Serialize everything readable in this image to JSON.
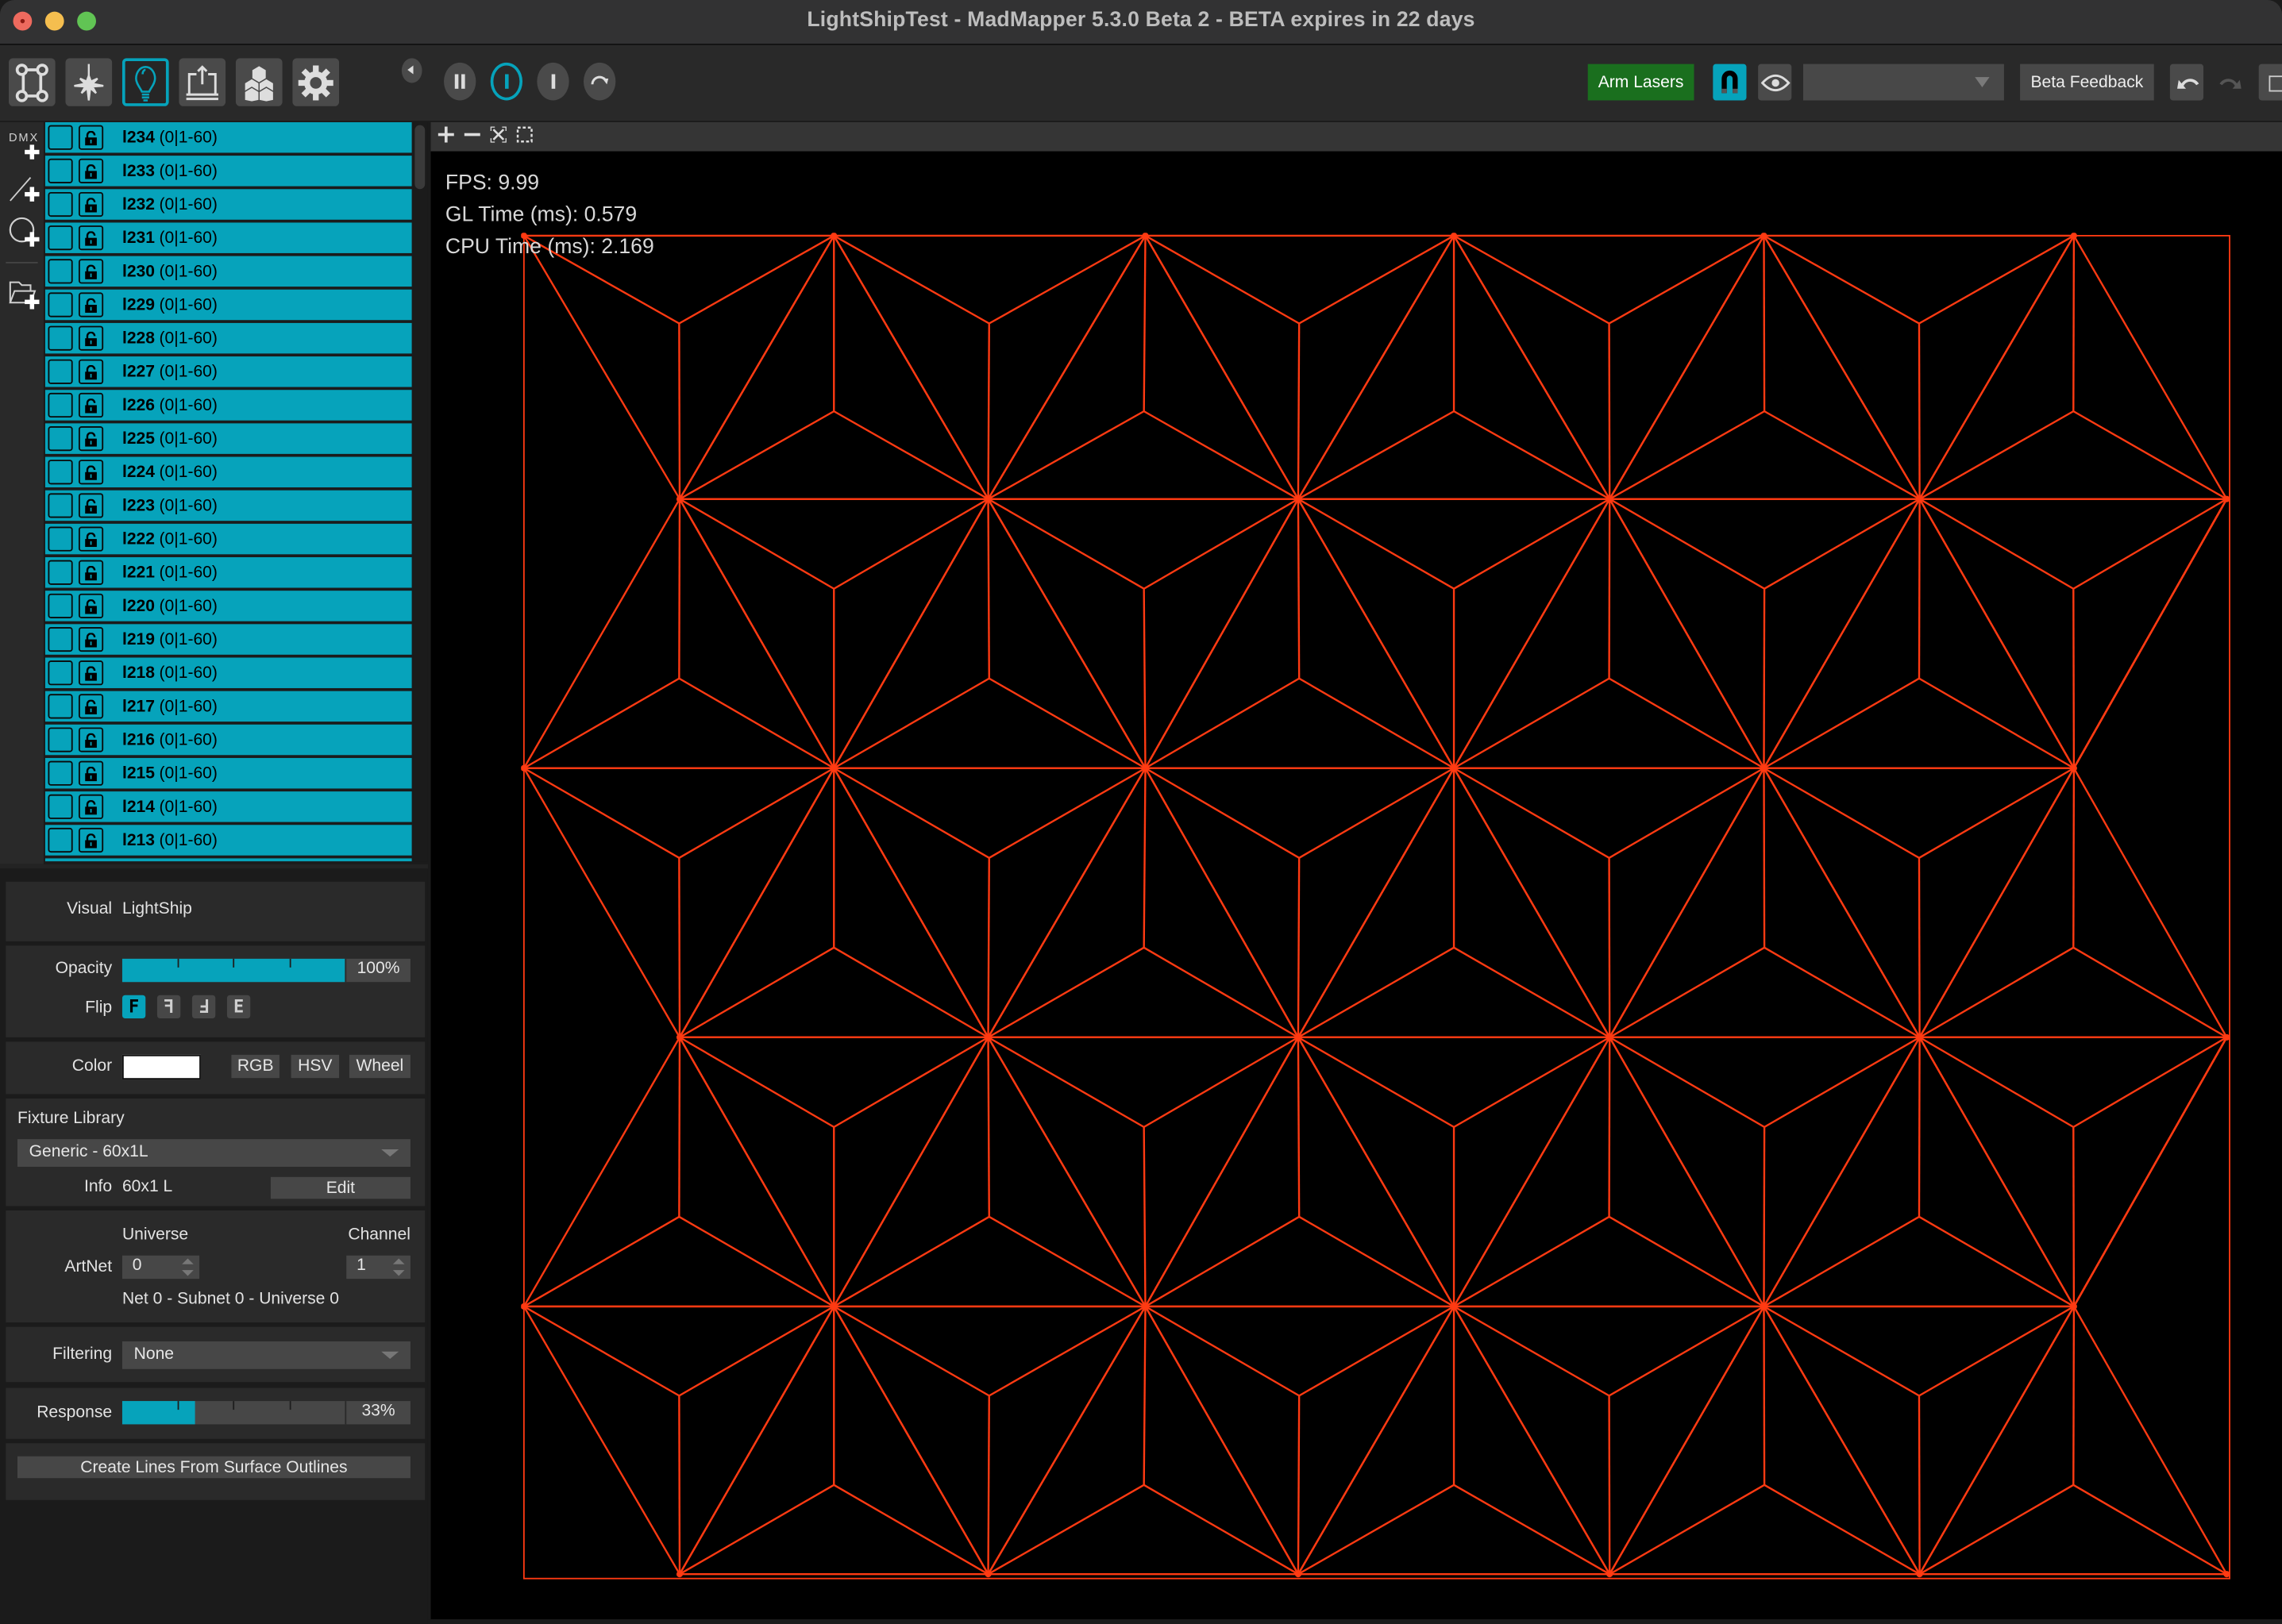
{
  "window": {
    "title": "LightShipTest - MadMapper 5.3.0 Beta 2 - BETA expires in 22 days"
  },
  "toolbar": {
    "mode_buttons": [
      {
        "name": "surfaces-mode",
        "icon": "quad-surface-icon",
        "active": false
      },
      {
        "name": "lasers-mode",
        "icon": "laser-burst-icon",
        "active": false
      },
      {
        "name": "fixtures-mode",
        "icon": "light-bulb-icon",
        "active": true
      },
      {
        "name": "output-mode",
        "icon": "output-export-icon",
        "active": false
      },
      {
        "name": "3d-objects-mode",
        "icon": "cubes-icon",
        "active": false
      },
      {
        "name": "preferences-mode",
        "icon": "gear-icon",
        "active": false
      }
    ],
    "transport": [
      {
        "name": "pause",
        "icon": "pause-icon",
        "active": false
      },
      {
        "name": "play",
        "icon": "play-bar-icon",
        "active": true
      },
      {
        "name": "step",
        "icon": "step-bar-icon",
        "active": false
      },
      {
        "name": "loop",
        "icon": "loop-arrow-icon",
        "active": false
      }
    ],
    "arm_lasers_label": "Arm Lasers",
    "output_select_value": "",
    "beta_feedback_label": "Beta Feedback",
    "accent_color": "#06a3bb",
    "arm_lasers_color": "#1a6f1e"
  },
  "left_strip": {
    "dmx_label": "DMX",
    "icons": [
      "dmx-add-icon",
      "line-add-icon",
      "circle-add-icon",
      "folder-add-icon"
    ]
  },
  "fixture_list": {
    "rows": [
      {
        "name": "l234",
        "range": "(0|1-60)"
      },
      {
        "name": "l233",
        "range": "(0|1-60)"
      },
      {
        "name": "l232",
        "range": "(0|1-60)"
      },
      {
        "name": "l231",
        "range": "(0|1-60)"
      },
      {
        "name": "l230",
        "range": "(0|1-60)"
      },
      {
        "name": "l229",
        "range": "(0|1-60)"
      },
      {
        "name": "l228",
        "range": "(0|1-60)"
      },
      {
        "name": "l227",
        "range": "(0|1-60)"
      },
      {
        "name": "l226",
        "range": "(0|1-60)"
      },
      {
        "name": "l225",
        "range": "(0|1-60)"
      },
      {
        "name": "l224",
        "range": "(0|1-60)"
      },
      {
        "name": "l223",
        "range": "(0|1-60)"
      },
      {
        "name": "l222",
        "range": "(0|1-60)"
      },
      {
        "name": "l221",
        "range": "(0|1-60)"
      },
      {
        "name": "l220",
        "range": "(0|1-60)"
      },
      {
        "name": "l219",
        "range": "(0|1-60)"
      },
      {
        "name": "l218",
        "range": "(0|1-60)"
      },
      {
        "name": "l217",
        "range": "(0|1-60)"
      },
      {
        "name": "l216",
        "range": "(0|1-60)"
      },
      {
        "name": "l215",
        "range": "(0|1-60)"
      },
      {
        "name": "l214",
        "range": "(0|1-60)"
      },
      {
        "name": "l213",
        "range": "(0|1-60)"
      },
      {
        "name": "",
        "range": ""
      }
    ],
    "row_color": "#06a3bb"
  },
  "inspector": {
    "visual_label": "Visual",
    "visual_value": "LightShip",
    "opacity_label": "Opacity",
    "opacity_value": 100,
    "opacity_text": "100%",
    "flip_label": "Flip",
    "flip_options": [
      "F",
      "ꟻ",
      "Ⅎ",
      "E"
    ],
    "flip_active_index": 0,
    "color_label": "Color",
    "color_value": "#ffffff",
    "color_modes": [
      "RGB",
      "HSV",
      "Wheel"
    ],
    "fixture_library_label": "Fixture Library",
    "fixture_library_value": "Generic - 60x1L",
    "info_label": "Info",
    "info_value": "60x1 L",
    "edit_label": "Edit",
    "universe_label": "Universe",
    "channel_label": "Channel",
    "artnet_label": "ArtNet",
    "universe_value": "0",
    "channel_value": "1",
    "net_info": "Net 0 - Subnet 0 - Universe 0",
    "filtering_label": "Filtering",
    "filtering_value": "None",
    "response_label": "Response",
    "response_value": 33,
    "response_text": "33%",
    "create_lines_label": "Create Lines From Surface Outlines"
  },
  "viewport": {
    "toolbar_icons": [
      "zoom-in-icon",
      "zoom-out-icon",
      "fit-view-icon",
      "select-rect-icon"
    ],
    "stats": {
      "fps": "FPS: 9.99",
      "gl_time": "GL Time (ms): 0.579",
      "cpu_time": "CPU Time (ms): 2.169"
    },
    "pattern_name": "asanoha hemp-leaf laser line grid",
    "line_color": "#ff3a12",
    "background_color": "#000000"
  }
}
